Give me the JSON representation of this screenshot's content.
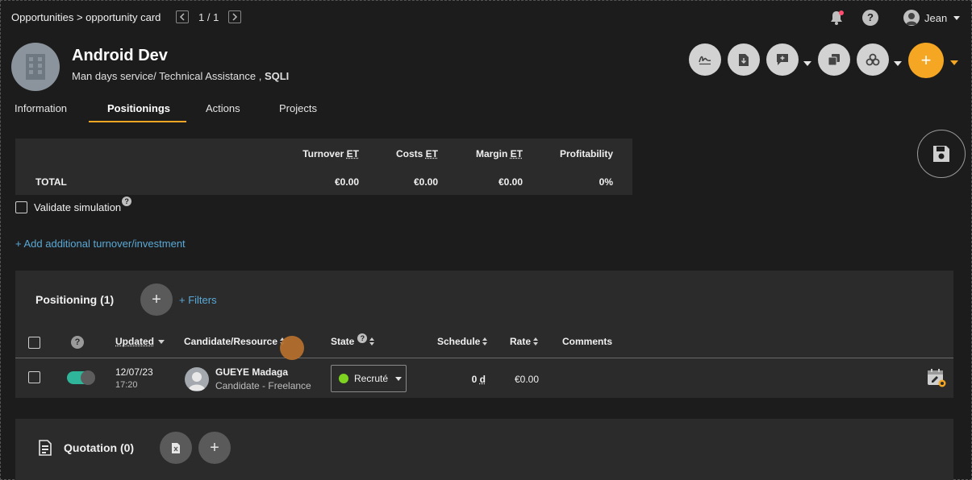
{
  "breadcrumb": {
    "parent": "Opportunities",
    "separator": ">",
    "current": "opportunity card"
  },
  "pager": {
    "text": "1 / 1"
  },
  "user": {
    "name": "Jean"
  },
  "opportunity": {
    "title": "Android Dev",
    "subtitle_prefix": "Man days service/ Technical Assistance ,",
    "company": "SQLI"
  },
  "action_icons": [
    "signature-icon",
    "document-download-icon",
    "comment-icon",
    "copy-icon",
    "group-icon",
    "plus-icon"
  ],
  "colors": {
    "accent": "#f5a623",
    "link": "#5aa9d6",
    "toggle_on": "#2fb59a",
    "state_green": "#7ed321"
  },
  "tabs": [
    {
      "label": "Information"
    },
    {
      "label": "Positionings",
      "active": true
    },
    {
      "label": "Actions"
    },
    {
      "label": "Projects"
    }
  ],
  "totals": {
    "headers": {
      "turnover_label": "Turnover",
      "costs_label": "Costs",
      "margin_label": "Margin",
      "et": "ET",
      "profitability": "Profitability"
    },
    "row_label": "TOTAL",
    "turnover": "€0.00",
    "costs": "€0.00",
    "margin": "€0.00",
    "profitability": "0%"
  },
  "validate": {
    "label": "Validate simulation",
    "help": "?"
  },
  "add_link": "+ Add additional turnover/investment",
  "positioning": {
    "title": "Positioning (1)",
    "add": "+",
    "filters": "+ Filters",
    "columns": {
      "help": "?",
      "updated": "Updated",
      "candidate": "Candidate/Resource",
      "state": "State",
      "state_help": "?",
      "schedule": "Schedule",
      "rate": "Rate",
      "comments": "Comments"
    },
    "rows": [
      {
        "date": "12/07/23",
        "time": "17:20",
        "name": "GUEYE Madaga",
        "type": "Candidate - Freelance",
        "state": "Recruté",
        "schedule_value": "0",
        "schedule_unit": "d",
        "rate": "€0.00",
        "comments": ""
      }
    ]
  },
  "quotation": {
    "title": "Quotation (0)",
    "add": "+"
  }
}
